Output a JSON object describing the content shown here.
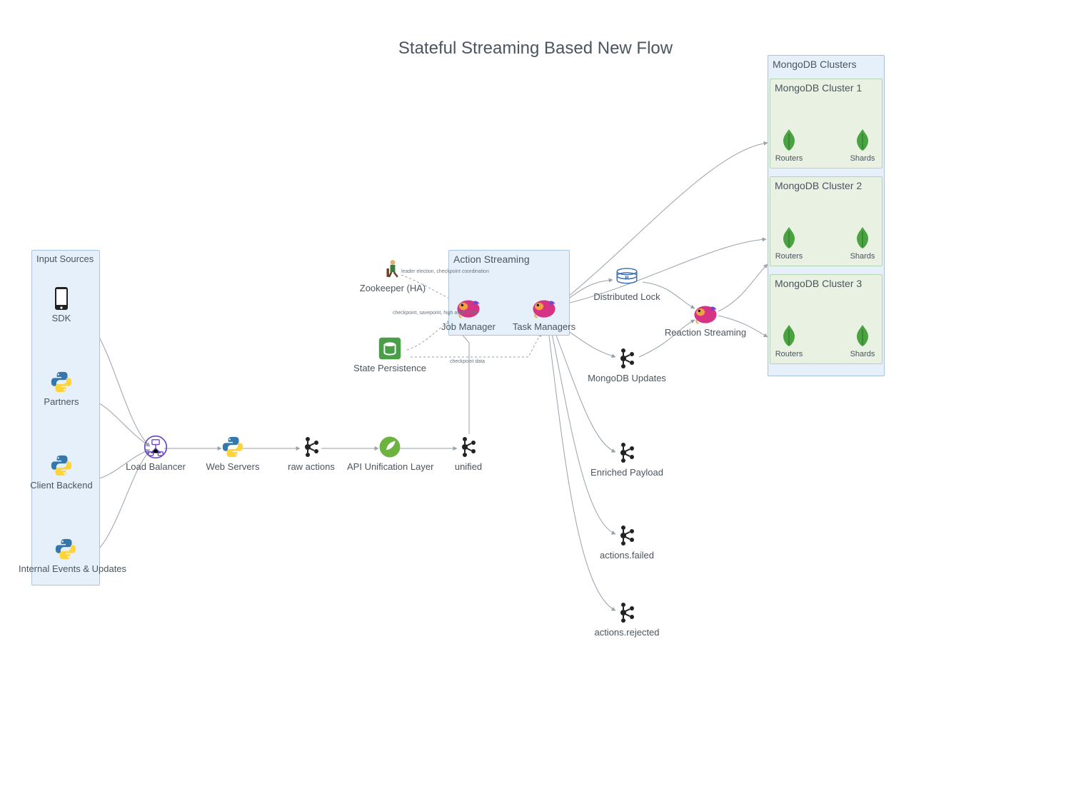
{
  "title": "Stateful Streaming Based New Flow",
  "groups": {
    "input_sources": {
      "title": "Input Sources"
    },
    "action_streaming": {
      "title": "Action Streaming"
    },
    "mongodb_clusters": {
      "title": "MongoDB Clusters",
      "clusters": [
        {
          "title": "MongoDB Cluster 1",
          "routers": "Routers",
          "shards": "Shards"
        },
        {
          "title": "MongoDB Cluster 2",
          "routers": "Routers",
          "shards": "Shards"
        },
        {
          "title": "MongoDB Cluster 3",
          "routers": "Routers",
          "shards": "Shards"
        }
      ]
    }
  },
  "nodes": {
    "sdk": "SDK",
    "partners": "Partners",
    "client_backend": "Client Backend",
    "internal_events": "Internal Events & Updates",
    "load_balancer": "Load Balancer",
    "web_servers": "Web Servers",
    "raw_actions": "raw actions",
    "api_unification": "API Unification Layer",
    "unified": "unified",
    "zookeeper": "Zookeeper (HA)",
    "state_persistence": "State Persistence",
    "job_manager": "Job Manager",
    "task_managers": "Task Managers",
    "distributed_lock": "Distributed Lock",
    "mongodb_updates": "MongoDB Updates",
    "enriched_payload": "Enriched Payload",
    "actions_failed": "actions.failed",
    "actions_rejected": "actions.rejected",
    "reaction_streaming": "Reaction Streaming"
  },
  "edge_labels": {
    "leader_election": "leader election, checkpoint coordination",
    "checkpoint_ha": "checkpoint, savepoint, high availability",
    "checkpoint_data": "checkpoint data"
  }
}
